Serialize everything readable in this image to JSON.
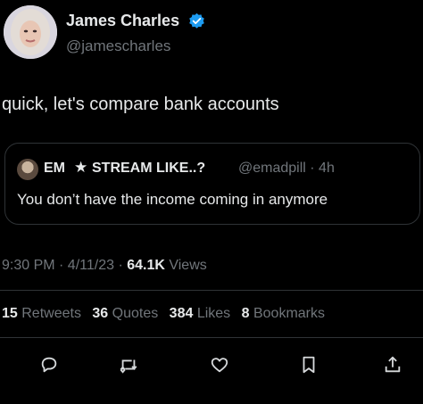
{
  "author": {
    "name": "James Charles",
    "handle": "@jamescharles",
    "verified_color": "#1d9bf0",
    "avatar_icon": "profile-photo"
  },
  "tweet": {
    "text": "quick, let's compare bank accounts"
  },
  "quote": {
    "name_prefix": "EM",
    "star_glyph": "★",
    "name_suffix": "STREAM LIKE..?",
    "handle_time": "@emadpill · 4h",
    "text": "You don’t have the income coming in anymore"
  },
  "meta": {
    "time_date": "9:30 PM · 4/11/23 · ",
    "views_count": "64.1K",
    "views_label": " Views"
  },
  "stats": {
    "retweets_count": "15",
    "retweets_label": " Retweets",
    "quotes_count": "36",
    "quotes_label": " Quotes",
    "likes_count": "384",
    "likes_label": " Likes",
    "bookmarks_count": "8",
    "bookmarks_label": " Bookmarks"
  },
  "actions": [
    "reply-icon",
    "retweet-icon",
    "like-icon",
    "bookmark-icon",
    "share-icon"
  ]
}
